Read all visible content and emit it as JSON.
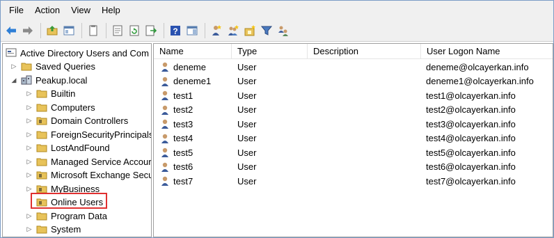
{
  "menu": [
    "File",
    "Action",
    "View",
    "Help"
  ],
  "toolbar": {
    "icons": [
      "back-arrow-icon",
      "forward-arrow-icon",
      "up-folder-icon",
      "show-hide-tree-icon",
      "copy-icon",
      "properties-icon",
      "refresh-icon",
      "export-list-icon",
      "help-icon",
      "action-pane-icon",
      "new-user-icon",
      "new-group-icon",
      "new-ou-icon",
      "filter-icon",
      "add-to-group-icon"
    ]
  },
  "tree": {
    "root": "Active Directory Users and Com",
    "items": [
      {
        "label": "Saved Queries"
      },
      {
        "label": "Peakup.local"
      },
      {
        "label": "Builtin"
      },
      {
        "label": "Computers"
      },
      {
        "label": "Domain Controllers"
      },
      {
        "label": "ForeignSecurityPrincipals"
      },
      {
        "label": "LostAndFound"
      },
      {
        "label": "Managed Service Accour"
      },
      {
        "label": "Microsoft Exchange Secu"
      },
      {
        "label": "MyBusiness"
      },
      {
        "label": "Online Users"
      },
      {
        "label": "Program Data"
      },
      {
        "label": "System"
      }
    ]
  },
  "list": {
    "columns": [
      "Name",
      "Type",
      "Description",
      "User Logon Name"
    ],
    "rows": [
      {
        "name": "deneme",
        "type": "User",
        "description": "",
        "upn": "deneme@olcayerkan.info"
      },
      {
        "name": "deneme1",
        "type": "User",
        "description": "",
        "upn": "deneme1@olcayerkan.info"
      },
      {
        "name": "test1",
        "type": "User",
        "description": "",
        "upn": "test1@olcayerkan.info"
      },
      {
        "name": "test2",
        "type": "User",
        "description": "",
        "upn": "test2@olcayerkan.info"
      },
      {
        "name": "test3",
        "type": "User",
        "description": "",
        "upn": "test3@olcayerkan.info"
      },
      {
        "name": "test4",
        "type": "User",
        "description": "",
        "upn": "test4@olcayerkan.info"
      },
      {
        "name": "test5",
        "type": "User",
        "description": "",
        "upn": "test5@olcayerkan.info"
      },
      {
        "name": "test6",
        "type": "User",
        "description": "",
        "upn": "test6@olcayerkan.info"
      },
      {
        "name": "test7",
        "type": "User",
        "description": "",
        "upn": "test7@olcayerkan.info"
      }
    ]
  },
  "colors": {
    "highlight_border": "#e03030",
    "folder": "#e8c35a",
    "menu_bg": "#f0f0f0"
  }
}
